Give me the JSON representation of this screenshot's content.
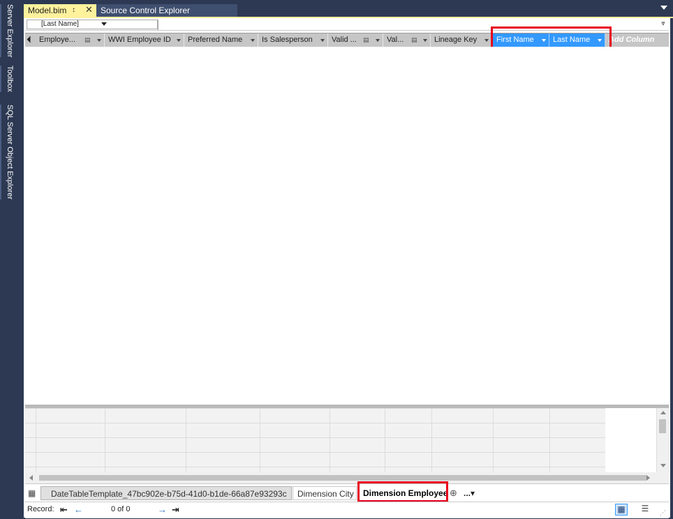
{
  "side_tabs": [
    "Server Explorer",
    "Toolbox",
    "SQL Server Object Explorer"
  ],
  "doc_tabs": {
    "active": "Model.bim",
    "inactive": "Source Control Explorer"
  },
  "formula_bar": {
    "column_selector": "[Last Name]"
  },
  "columns": [
    "Employe...",
    "WWI Employee ID",
    "Preferred Name",
    "Is Salesperson",
    "Valid ...",
    "Val...",
    "Lineage Key",
    "First Name",
    "Last Name"
  ],
  "add_column_label": "Add Column",
  "table_tabs": [
    "DateTableTemplate_47bc902e-b75d-41d0-b1de-66a87e93293c",
    "Dimension City",
    "Dimension Employee"
  ],
  "more_tabs": "...",
  "status": {
    "record_label": "Record:",
    "record_count": "0 of 0"
  },
  "colors": {
    "rail": "#2d3953",
    "active_tab": "#fff29d",
    "selected_column": "#3399ff",
    "highlight": "#e8001c"
  }
}
